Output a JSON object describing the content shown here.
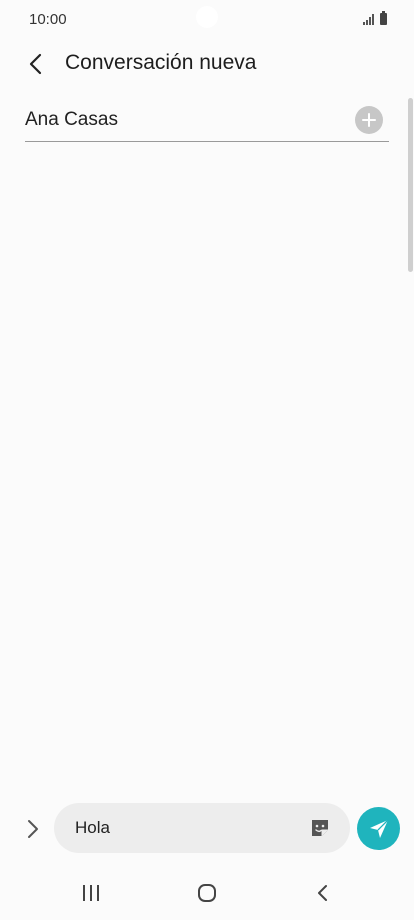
{
  "status_bar": {
    "time": "10:00"
  },
  "header": {
    "title": "Conversación nueva"
  },
  "recipient": {
    "name": "Ana Casas"
  },
  "composer": {
    "message_text": "Hola"
  },
  "colors": {
    "send_button": "#1fb4bd",
    "add_button": "#c7c7c7",
    "input_background": "#ededed",
    "background": "#fbfbfb"
  },
  "icons": {
    "back": "chevron-left-icon",
    "add": "plus-circle-icon",
    "expand": "chevron-right-icon",
    "sticker": "sticker-icon",
    "send": "send-icon",
    "nav_recents": "recents-icon",
    "nav_home": "home-icon",
    "nav_back": "back-icon"
  }
}
